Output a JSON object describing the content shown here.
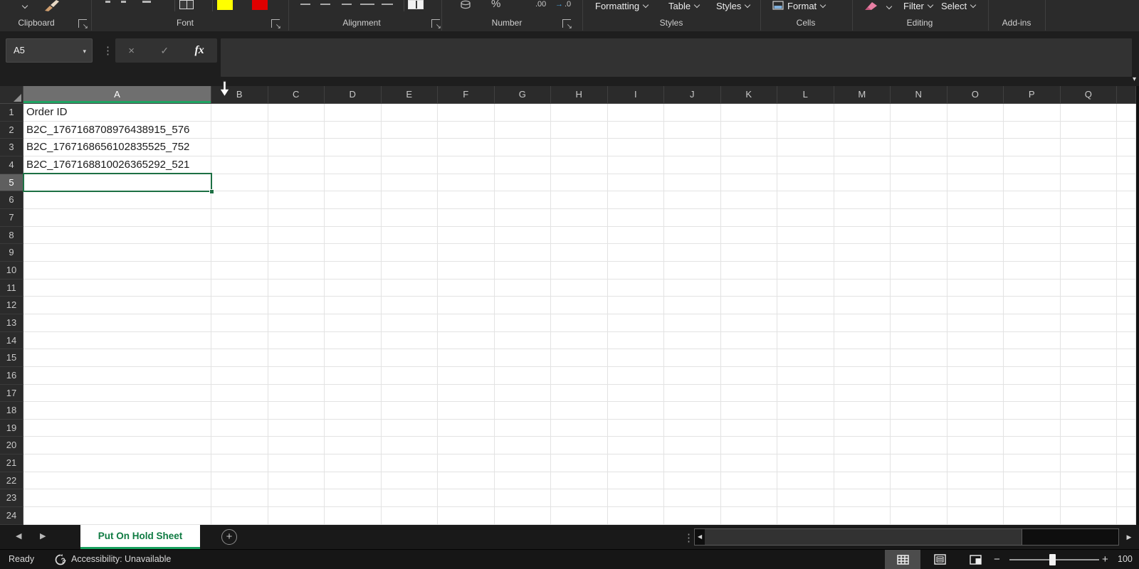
{
  "ribbon": {
    "groups": {
      "clipboard": "Clipboard",
      "font": "Font",
      "alignment": "Alignment",
      "number": "Number",
      "styles": "Styles",
      "cells": "Cells",
      "editing": "Editing",
      "addins": "Add-ins"
    },
    "buttons": {
      "formatting": "Formatting",
      "table": "Table",
      "styles": "Styles",
      "format": "Format",
      "filter": "Filter",
      "select": "Select"
    },
    "number_tools": {
      "percent": "%",
      "increase_decimal": ".00",
      "decrease_decimal": ".0"
    }
  },
  "formula_bar": {
    "name_box": "A5",
    "cancel": "×",
    "enter": "✓",
    "insert_function": "fx",
    "formula": ""
  },
  "grid": {
    "columns": [
      "A",
      "B",
      "C",
      "D",
      "E",
      "F",
      "G",
      "H",
      "I",
      "J",
      "K",
      "L",
      "M",
      "N",
      "O",
      "P",
      "Q"
    ],
    "row_count": 24,
    "selected_column": "A",
    "selected_row": 5,
    "active_cell": "A5",
    "cells": {
      "A1": "Order ID",
      "A2": "B2C_1767168708976438915_576",
      "A3": "B2C_1767168656102835525_752",
      "A4": "B2C_1767168810026365292_521"
    }
  },
  "sheet_bar": {
    "active_tab": "Put On Hold Sheet"
  },
  "status_bar": {
    "mode": "Ready",
    "accessibility": "Accessibility: Unavailable",
    "zoom_level": "100"
  },
  "colors": {
    "accent_green": "#107C41",
    "selection_border": "#1E7145",
    "fill_yellow": "#FFFF00",
    "font_red": "#E00000"
  }
}
